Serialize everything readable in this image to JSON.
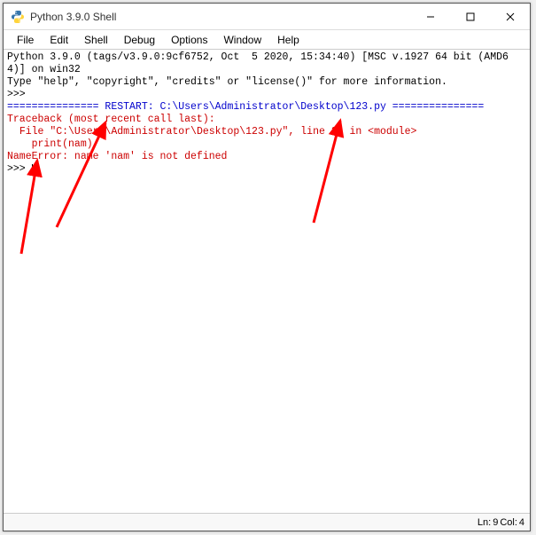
{
  "window": {
    "title": "Python 3.9.0 Shell"
  },
  "menu": {
    "file": "File",
    "edit": "Edit",
    "shell": "Shell",
    "debug": "Debug",
    "options": "Options",
    "window": "Window",
    "help": "Help"
  },
  "console": {
    "banner1": "Python 3.9.0 (tags/v3.9.0:9cf6752, Oct  5 2020, 15:34:40) [MSC v.1927 64 bit (AMD64)] on win32",
    "banner2": "Type \"help\", \"copyright\", \"credits\" or \"license()\" for more information.",
    "prompt1": ">>> ",
    "restart": "=============== RESTART: C:\\Users\\Administrator\\Desktop\\123.py ===============",
    "tb1": "Traceback (most recent call last):",
    "tb2": "  File \"C:\\Users\\Administrator\\Desktop\\123.py\", line 2, in <module>",
    "tb3": "    print(nam)",
    "tb4": "NameError: name 'nam' is not defined",
    "prompt2": ">>> "
  },
  "status": {
    "ln_label": "Ln:",
    "ln": "9",
    "col_label": "Col:",
    "col": "4"
  }
}
